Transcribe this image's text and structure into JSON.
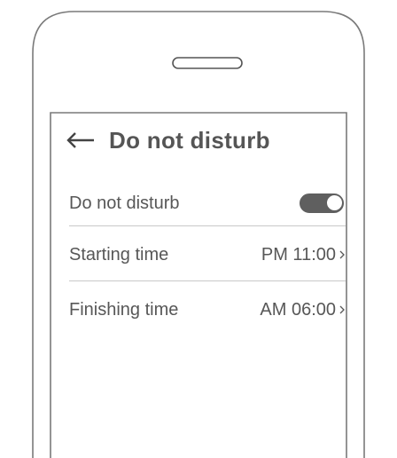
{
  "header": {
    "title": "Do not disturb",
    "back_icon": "arrow-left-icon"
  },
  "settings": {
    "do_not_disturb": {
      "label": "Do not disturb",
      "enabled": true
    },
    "starting_time": {
      "label": "Starting time",
      "value": "PM 11:00",
      "icon": "chevron-right-icon"
    },
    "finishing_time": {
      "label": "Finishing time",
      "value": "AM 06:00",
      "icon": "chevron-right-icon"
    }
  },
  "colors": {
    "outline": "#7a7a7a",
    "text": "#575757",
    "toggle_on": "#5f5f5f",
    "divider": "#c8c8c8"
  }
}
